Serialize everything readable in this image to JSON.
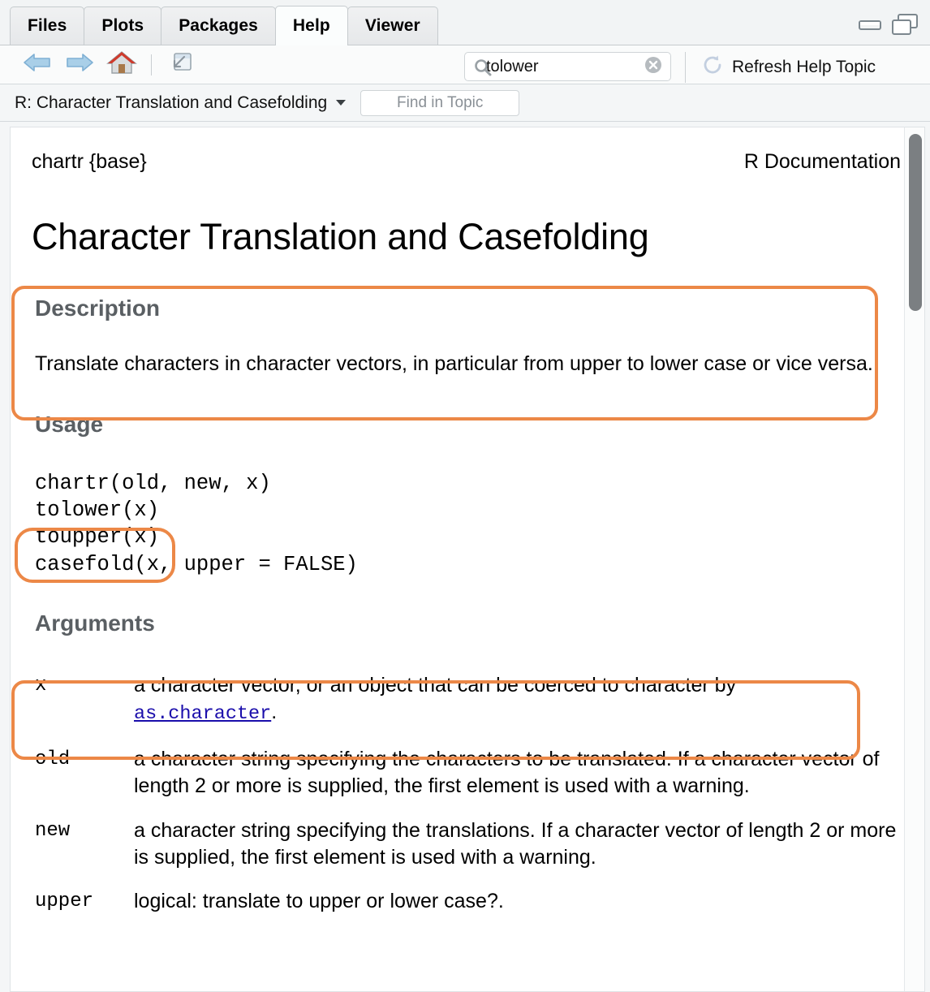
{
  "window": {
    "tabs": [
      {
        "label": "Files",
        "active": false
      },
      {
        "label": "Plots",
        "active": false
      },
      {
        "label": "Packages",
        "active": false
      },
      {
        "label": "Help",
        "active": true
      },
      {
        "label": "Viewer",
        "active": false
      }
    ],
    "controls": {
      "minimize_icon": "minimize-icon",
      "maximize_icon": "maximize-restore-icon"
    }
  },
  "toolbar": {
    "back_icon": "back-arrow-icon",
    "forward_icon": "forward-arrow-icon",
    "home_icon": "home-icon",
    "popout_icon": "show-in-new-window-icon",
    "search": {
      "icon": "search-icon",
      "value": "tolower",
      "placeholder": "Search",
      "clear_icon": "clear-icon"
    },
    "refresh": {
      "icon": "refresh-icon",
      "label": "Refresh Help Topic"
    }
  },
  "topicbar": {
    "title": "R: Character Translation and Casefolding",
    "dropdown_icon": "chevron-down-icon",
    "find_placeholder": "Find in Topic",
    "find_value": ""
  },
  "document": {
    "package_header": "chartr {base}",
    "doc_type": "R Documentation",
    "title": "Character Translation and Casefolding",
    "sections": {
      "description": {
        "heading": "Description",
        "text": "Translate characters in character vectors, in particular from upper to lower case or vice versa."
      },
      "usage": {
        "heading": "Usage",
        "code": "chartr(old, new, x)\ntolower(x)\ntoupper(x)\ncasefold(x, upper = FALSE)"
      },
      "arguments": {
        "heading": "Arguments",
        "items": [
          {
            "name": "x",
            "desc_before_link": "a character vector, or an object that can be coerced to character by ",
            "link": "as.character",
            "desc_after_link": "."
          },
          {
            "name": "old",
            "desc_before_link": "a character string specifying the characters to be translated. If a character vector of length 2 or more is supplied, the first element is used with a warning.",
            "link": "",
            "desc_after_link": ""
          },
          {
            "name": "new",
            "desc_before_link": "a character string specifying the translations. If a character vector of length 2 or more is supplied, the first element is used with a warning.",
            "link": "",
            "desc_after_link": ""
          },
          {
            "name": "upper",
            "desc_before_link": "logical: translate to upper or lower case?.",
            "link": "",
            "desc_after_link": ""
          }
        ]
      }
    }
  },
  "annotations": {
    "color": "#ec8847",
    "boxes": [
      {
        "id": "hl-description",
        "target": "description-section"
      },
      {
        "id": "hl-usage",
        "target": "usage-tolower-toupper-lines"
      },
      {
        "id": "hl-argx",
        "target": "argument-x-row"
      }
    ]
  },
  "scrollbar": {
    "thumb_top_pct": 1,
    "thumb_height_pct": 20
  }
}
